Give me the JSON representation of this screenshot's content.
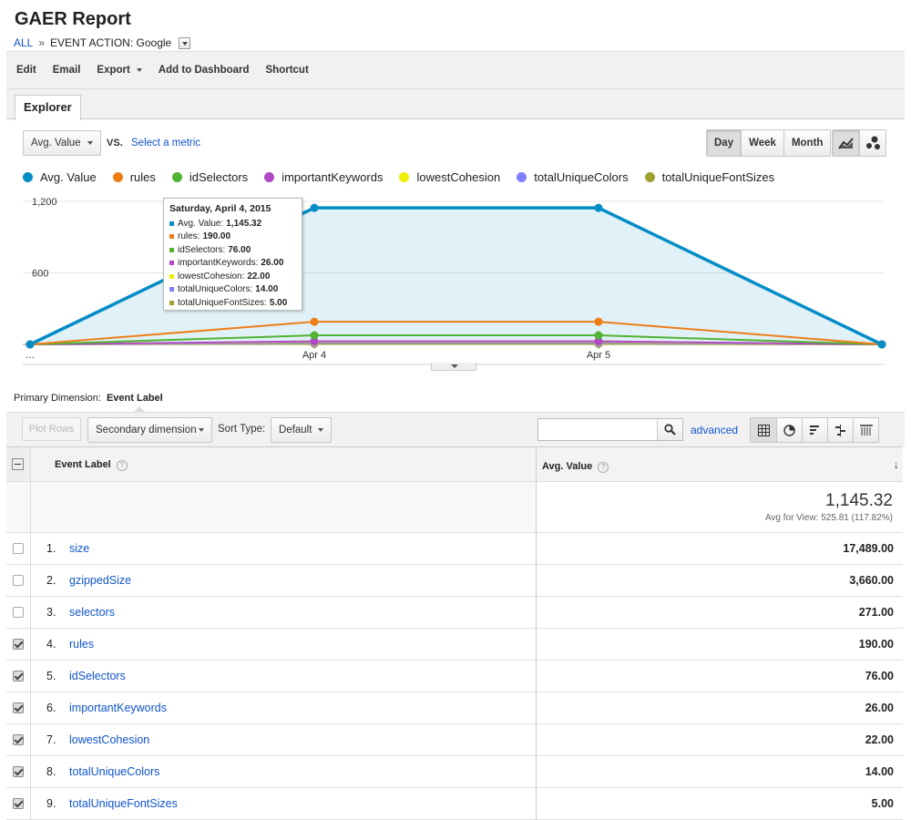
{
  "header": {
    "title": "GAER Report",
    "breadcrumb_all": "ALL",
    "breadcrumb_sep": "»",
    "breadcrumb_current": "EVENT ACTION: Google"
  },
  "toolbar": {
    "edit": "Edit",
    "email": "Email",
    "export": "Export",
    "add_to_dashboard": "Add to Dashboard",
    "shortcut": "Shortcut"
  },
  "tabs": [
    {
      "label": "Explorer"
    }
  ],
  "metric_select": {
    "value": "Avg. Value",
    "vs": "VS.",
    "select_metric": "Select a metric"
  },
  "granularity": {
    "day": "Day",
    "week": "Week",
    "month": "Month",
    "selected": "Day"
  },
  "chart_type_buttons": {
    "line_icon": "line-chart-icon",
    "motion_icon": "motion-chart-icon"
  },
  "colors": {
    "avg_value": "#058dc7",
    "rules": "#ed7e17",
    "idSelectors": "#50b432",
    "importantKeywords": "#af49c5",
    "lowestCohesion": "#edef00",
    "totalUniqueColors": "#8080ff",
    "totalUniqueFontSizes": "#a0a030",
    "link": "#1155cc"
  },
  "chart_data": {
    "type": "area",
    "x": [
      "…",
      "Apr 4",
      "Apr 5",
      ""
    ],
    "ylim": [
      0,
      1200
    ],
    "y_ticks": [
      "600",
      "1,200"
    ],
    "x_tick_labels": [
      "…",
      "Apr 4",
      "Apr 5"
    ],
    "grid": true,
    "legend": "top",
    "series": [
      {
        "name": "Avg. Value",
        "values": [
          0,
          1145.32,
          1145.32,
          0
        ],
        "color": "#058dc7",
        "fill": true
      },
      {
        "name": "rules",
        "values": [
          0,
          190,
          190,
          0
        ],
        "color": "#ed7e17"
      },
      {
        "name": "idSelectors",
        "values": [
          0,
          76,
          76,
          0
        ],
        "color": "#50b432"
      },
      {
        "name": "importantKeywords",
        "values": [
          0,
          26,
          26,
          0
        ],
        "color": "#af49c5"
      },
      {
        "name": "lowestCohesion",
        "values": [
          0,
          22,
          22,
          0
        ],
        "color": "#edef00"
      },
      {
        "name": "totalUniqueColors",
        "values": [
          0,
          14,
          14,
          0
        ],
        "color": "#8080ff"
      },
      {
        "name": "totalUniqueFontSizes",
        "values": [
          0,
          5,
          5,
          0
        ],
        "color": "#a0a030"
      }
    ]
  },
  "tooltip": {
    "date": "Saturday, April 4, 2015",
    "rows": [
      {
        "label": "Avg. Value:",
        "value": "1,145.32",
        "color": "#058dc7"
      },
      {
        "label": "rules:",
        "value": "190.00",
        "color": "#ed7e17"
      },
      {
        "label": "idSelectors:",
        "value": "76.00",
        "color": "#50b432"
      },
      {
        "label": "importantKeywords:",
        "value": "26.00",
        "color": "#af49c5"
      },
      {
        "label": "lowestCohesion:",
        "value": "22.00",
        "color": "#edef00"
      },
      {
        "label": "totalUniqueColors:",
        "value": "14.00",
        "color": "#8080ff"
      },
      {
        "label": "totalUniqueFontSizes:",
        "value": "5.00",
        "color": "#a0a030"
      }
    ]
  },
  "primary_dimension": {
    "label": "Primary Dimension:",
    "value": "Event Label"
  },
  "table_toolbar": {
    "plot_rows": "Plot Rows",
    "secondary_dimension": "Secondary dimension",
    "sort_type_label": "Sort Type:",
    "sort_type_value": "Default",
    "search_placeholder": "",
    "advanced": "advanced"
  },
  "table": {
    "col_event_label": "Event Label",
    "col_avg_value": "Avg. Value",
    "help": "?",
    "total_value": "1,145.32",
    "total_sub": "Avg for View: 525.81 (117.82%)",
    "rows": [
      {
        "index": "1.",
        "label": "size",
        "value": "17,489.00",
        "checked": false
      },
      {
        "index": "2.",
        "label": "gzippedSize",
        "value": "3,660.00",
        "checked": false
      },
      {
        "index": "3.",
        "label": "selectors",
        "value": "271.00",
        "checked": false
      },
      {
        "index": "4.",
        "label": "rules",
        "value": "190.00",
        "checked": true
      },
      {
        "index": "5.",
        "label": "idSelectors",
        "value": "76.00",
        "checked": true
      },
      {
        "index": "6.",
        "label": "importantKeywords",
        "value": "26.00",
        "checked": true
      },
      {
        "index": "7.",
        "label": "lowestCohesion",
        "value": "22.00",
        "checked": true
      },
      {
        "index": "8.",
        "label": "totalUniqueColors",
        "value": "14.00",
        "checked": true
      },
      {
        "index": "9.",
        "label": "totalUniqueFontSizes",
        "value": "5.00",
        "checked": true
      }
    ]
  }
}
